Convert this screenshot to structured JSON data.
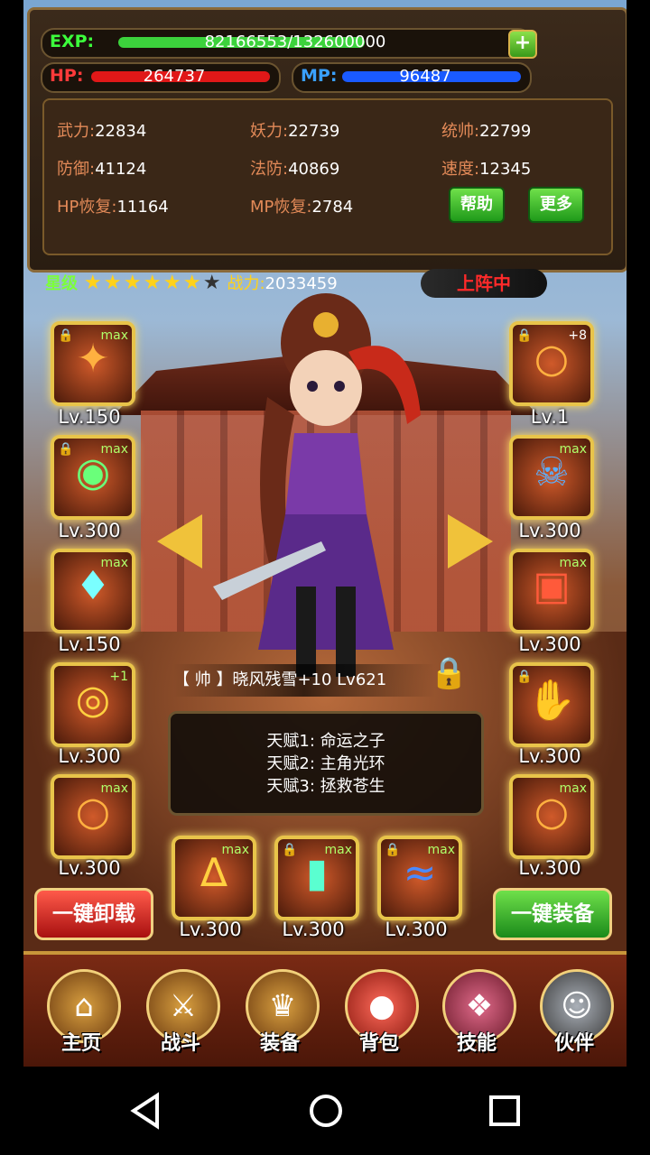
{
  "exp": {
    "label": "EXP:",
    "value": "82166553/132600000",
    "progress": 0.62
  },
  "hp": {
    "label": "HP:",
    "value": "264737"
  },
  "mp": {
    "label": "MP:",
    "value": "96487"
  },
  "stats": [
    {
      "key": "武力:",
      "value": "22834"
    },
    {
      "key": "妖力:",
      "value": "22739"
    },
    {
      "key": "统帅:",
      "value": "22799"
    },
    {
      "key": "防御:",
      "value": "41124"
    },
    {
      "key": "法防:",
      "value": "40869"
    },
    {
      "key": "速度:",
      "value": "12345"
    },
    {
      "key": "HP恢复:",
      "value": "11164"
    },
    {
      "key": "MP恢复:",
      "value": "2784"
    }
  ],
  "buttons": {
    "help": "帮助",
    "more": "更多",
    "add": "+"
  },
  "rating": {
    "label": "星级",
    "stars_filled": 6,
    "stars_total": 7,
    "power_label": "战力:",
    "power_value": "2033459"
  },
  "status": "上阵中",
  "left_slots": [
    {
      "level": "Lv.150",
      "tag": "max",
      "icon": "helmet-icon"
    },
    {
      "level": "Lv.300",
      "tag": "max",
      "icon": "orb-icon"
    },
    {
      "level": "Lv.150",
      "tag": "max",
      "icon": "gem-icon"
    },
    {
      "level": "Lv.300",
      "tag": "+1",
      "icon": "bracelet-icon"
    },
    {
      "level": "Lv.300",
      "tag": "max",
      "icon": "ring-icon"
    }
  ],
  "right_slots": [
    {
      "level": "Lv.1",
      "tag": "+8",
      "icon": "necklace-icon"
    },
    {
      "level": "Lv.300",
      "tag": "max",
      "icon": "mask-icon"
    },
    {
      "level": "Lv.300",
      "tag": "max",
      "icon": "armor-icon"
    },
    {
      "level": "Lv.300",
      "tag": "",
      "icon": "gauntlet-icon"
    },
    {
      "level": "Lv.300",
      "tag": "max",
      "icon": "ring-icon"
    }
  ],
  "bottom_slots": [
    {
      "level": "Lv.300",
      "tag": "max",
      "icon": "pagoda-icon"
    },
    {
      "level": "Lv.300",
      "tag": "max",
      "icon": "boots-icon"
    },
    {
      "level": "Lv.300",
      "tag": "max",
      "icon": "dragon-icon"
    }
  ],
  "hero": {
    "name": "【 帅 】晓风残雪+10 Lv621"
  },
  "talents": [
    "天赋1:  命运之子",
    "天赋2:  主角光环",
    "天赋3:  拯救苍生"
  ],
  "actions": {
    "unequip_all": "一键卸载",
    "equip_all": "一键装备"
  },
  "nav": [
    {
      "label": "主页",
      "icon": "home-icon"
    },
    {
      "label": "战斗",
      "icon": "swords-icon"
    },
    {
      "label": "装备",
      "icon": "helmet-icon"
    },
    {
      "label": "背包",
      "icon": "bag-icon"
    },
    {
      "label": "技能",
      "icon": "skill-icon"
    },
    {
      "label": "伙伴",
      "icon": "partner-icon"
    }
  ]
}
